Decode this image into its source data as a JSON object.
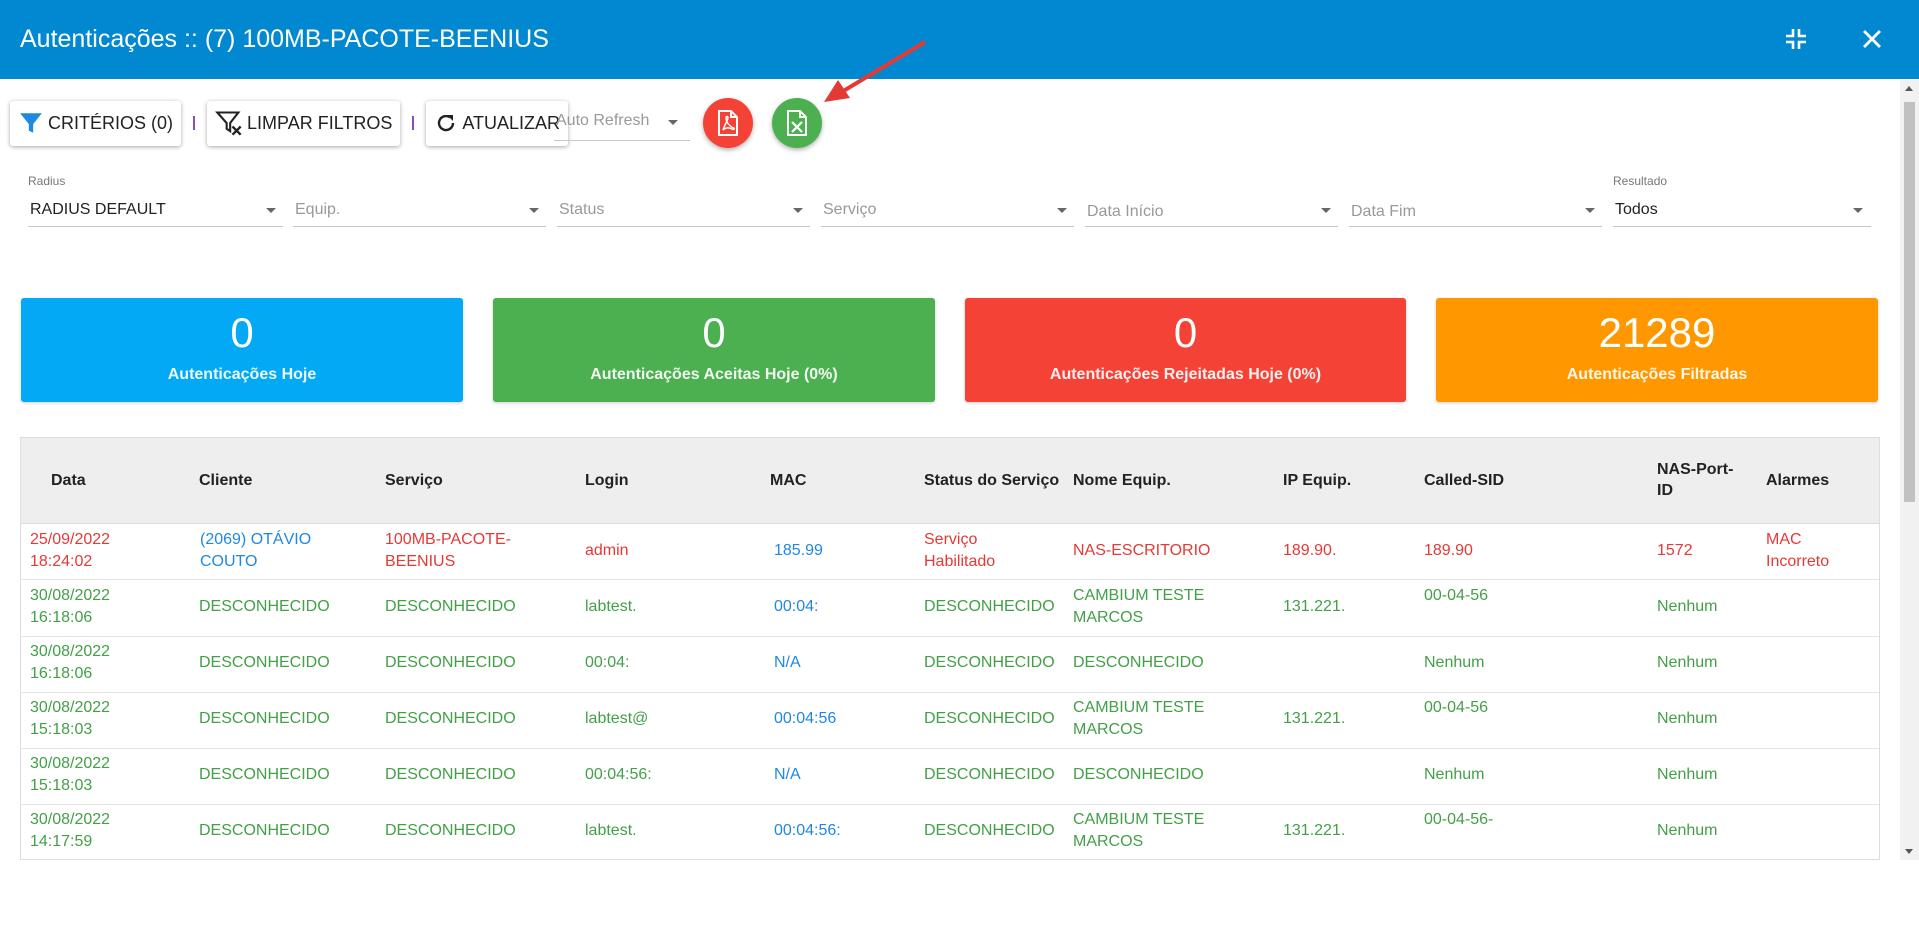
{
  "header": {
    "title": "Autenticações :: (7) 100MB-PACOTE-BEENIUS",
    "minimize_icon": "compress-icon",
    "close_icon": "close-icon"
  },
  "toolbar": {
    "criterios_label": "CRITÉRIOS (0)",
    "limpar_label": "LIMPAR FILTROS",
    "atualizar_label": "ATUALIZAR",
    "auto_refresh_placeholder": "Auto Refresh",
    "pdf_icon": "pdf-icon",
    "excel_icon": "excel-icon"
  },
  "filters": {
    "radius": {
      "label": "Radius",
      "value": "RADIUS DEFAULT"
    },
    "equip": {
      "placeholder": "Equip."
    },
    "status": {
      "placeholder": "Status"
    },
    "servico": {
      "placeholder": "Serviço"
    },
    "data_inicio": {
      "placeholder": "Data Início"
    },
    "data_fim": {
      "placeholder": "Data Fim"
    },
    "resultado": {
      "label": "Resultado",
      "value": "Todos"
    }
  },
  "cards": [
    {
      "value": "0",
      "label": "Autenticações Hoje",
      "color": "#03a9f4"
    },
    {
      "value": "0",
      "label": "Autenticações Aceitas Hoje (0%)",
      "color": "#4caf50"
    },
    {
      "value": "0",
      "label": "Autenticações Rejeitadas Hoje (0%)",
      "color": "#f44336"
    },
    {
      "value": "21289",
      "label": "Autenticações Filtradas",
      "color": "#ff9800"
    }
  ],
  "table": {
    "headers": {
      "data": "Data",
      "cliente": "Cliente",
      "servico": "Serviço",
      "login": "Login",
      "mac": "MAC",
      "status_servico": "Status do Serviço",
      "nome_equip": "Nome Equip.",
      "ip_equip": "IP Equip.",
      "called_sid": "Called-SID",
      "nas_port_1": "NAS-Port-",
      "nas_port_2": "ID",
      "alarmes": "Alarmes"
    },
    "rows": [
      {
        "date": "25/09/2022",
        "time": "18:24:02",
        "cliente1": "(2069) OTÁVIO",
        "cliente2": "COUTO",
        "servico1": "100MB-PACOTE-",
        "servico2": "BEENIUS",
        "login": "admin",
        "mac": "185.99",
        "status1": "Serviço",
        "status2": "Habilitado",
        "equip1": "NAS-ESCRITORIO",
        "equip2": "",
        "ip": "189.90.",
        "called": "189.90",
        "nas": "1572",
        "alarm1": "MAC",
        "alarm2": "Incorreto"
      },
      {
        "date": "30/08/2022",
        "time": "16:18:06",
        "cliente1": "DESCONHECIDO",
        "cliente2": "",
        "servico1": "DESCONHECIDO",
        "servico2": "",
        "login": "labtest.",
        "mac": "00:04:",
        "status1": "DESCONHECIDO",
        "status2": "",
        "equip1": "CAMBIUM TESTE",
        "equip2": "MARCOS",
        "ip": "131.221.",
        "called": "00-04-56",
        "nas": "Nenhum",
        "alarm1": "",
        "alarm2": ""
      },
      {
        "date": "30/08/2022",
        "time": "16:18:06",
        "cliente1": "DESCONHECIDO",
        "cliente2": "",
        "servico1": "DESCONHECIDO",
        "servico2": "",
        "login": "00:04:",
        "mac": "N/A",
        "status1": "DESCONHECIDO",
        "status2": "",
        "equip1": "DESCONHECIDO",
        "equip2": "",
        "ip": "",
        "called": "Nenhum",
        "nas": "Nenhum",
        "alarm1": "",
        "alarm2": ""
      },
      {
        "date": "30/08/2022",
        "time": "15:18:03",
        "cliente1": "DESCONHECIDO",
        "cliente2": "",
        "servico1": "DESCONHECIDO",
        "servico2": "",
        "login": "labtest@",
        "mac": "00:04:56",
        "status1": "DESCONHECIDO",
        "status2": "",
        "equip1": "CAMBIUM TESTE",
        "equip2": "MARCOS",
        "ip": "131.221.",
        "called": "00-04-56",
        "nas": "Nenhum",
        "alarm1": "",
        "alarm2": ""
      },
      {
        "date": "30/08/2022",
        "time": "15:18:03",
        "cliente1": "DESCONHECIDO",
        "cliente2": "",
        "servico1": "DESCONHECIDO",
        "servico2": "",
        "login": "00:04:56:",
        "mac": "N/A",
        "status1": "DESCONHECIDO",
        "status2": "",
        "equip1": "DESCONHECIDO",
        "equip2": "",
        "ip": "",
        "called": "Nenhum",
        "nas": "Nenhum",
        "alarm1": "",
        "alarm2": ""
      },
      {
        "date": "30/08/2022",
        "time": "14:17:59",
        "cliente1": "DESCONHECIDO",
        "cliente2": "",
        "servico1": "DESCONHECIDO",
        "servico2": "",
        "login": "labtest.",
        "mac": "00:04:56:",
        "status1": "DESCONHECIDO",
        "status2": "",
        "equip1": "CAMBIUM TESTE",
        "equip2": "MARCOS",
        "ip": "131.221.",
        "called": "00-04-56-",
        "nas": "Nenhum",
        "alarm1": "",
        "alarm2": ""
      }
    ]
  },
  "colors": {
    "header_bg": "#0288d1",
    "rejected_text": "#e53935",
    "accepted_text": "#43a047",
    "link_text": "#1e88e5"
  }
}
